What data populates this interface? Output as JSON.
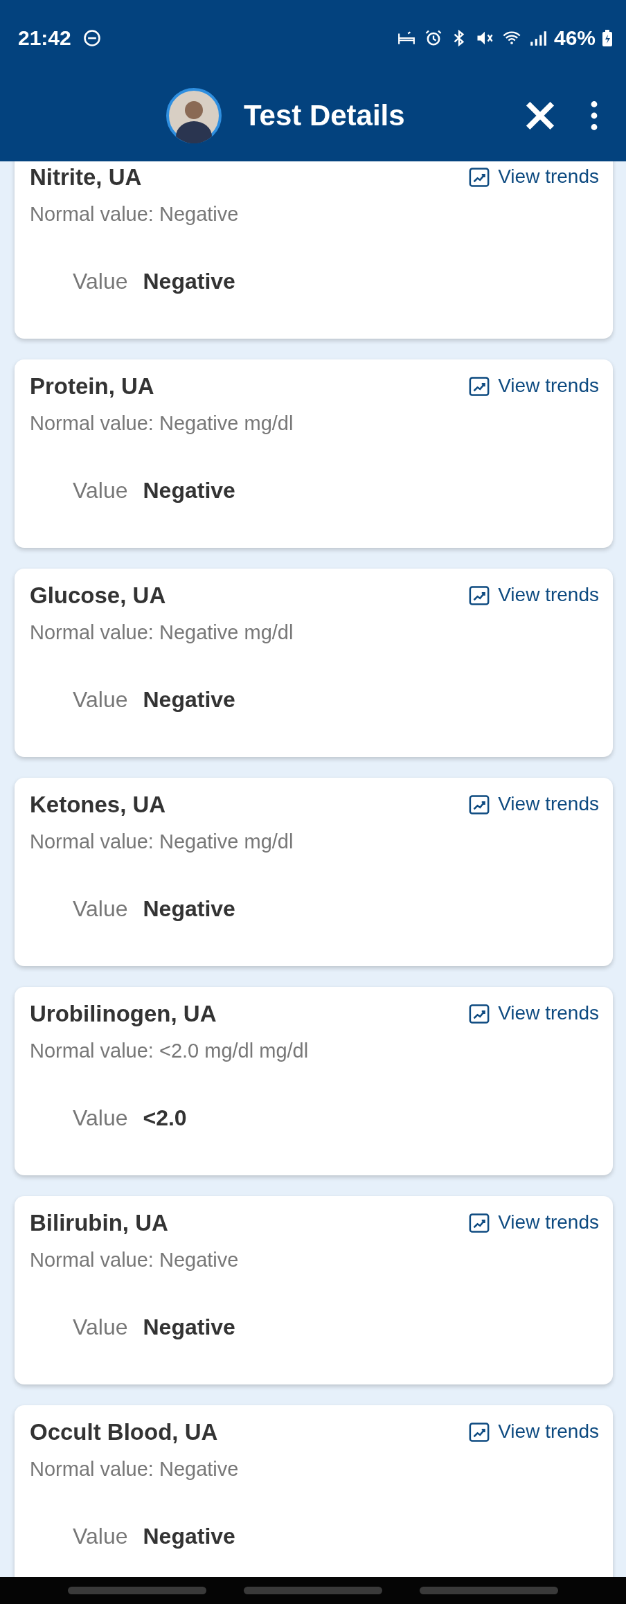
{
  "status_bar": {
    "time": "21:42",
    "battery": "46%"
  },
  "header": {
    "title": "Test Details"
  },
  "tests": [
    {
      "name": "Nitrite, UA",
      "normal_value": "Normal value: Negative",
      "value_label": "Value",
      "value": "Negative",
      "trends_link": "View trends"
    },
    {
      "name": "Protein, UA",
      "normal_value": "Normal value: Negative mg/dl",
      "value_label": "Value",
      "value": "Negative",
      "trends_link": "View trends"
    },
    {
      "name": "Glucose, UA",
      "normal_value": "Normal value: Negative mg/dl",
      "value_label": "Value",
      "value": "Negative",
      "trends_link": "View trends"
    },
    {
      "name": "Ketones, UA",
      "normal_value": "Normal value: Negative mg/dl",
      "value_label": "Value",
      "value": "Negative",
      "trends_link": "View trends"
    },
    {
      "name": "Urobilinogen, UA",
      "normal_value": "Normal value: <2.0 mg/dl mg/dl",
      "value_label": "Value",
      "value": "<2.0",
      "trends_link": "View trends"
    },
    {
      "name": "Bilirubin, UA",
      "normal_value": "Normal value: Negative",
      "value_label": "Value",
      "value": "Negative",
      "trends_link": "View trends"
    },
    {
      "name": "Occult Blood, UA",
      "normal_value": "Normal value: Negative",
      "value_label": "Value",
      "value": "Negative",
      "trends_link": "View trends"
    }
  ]
}
